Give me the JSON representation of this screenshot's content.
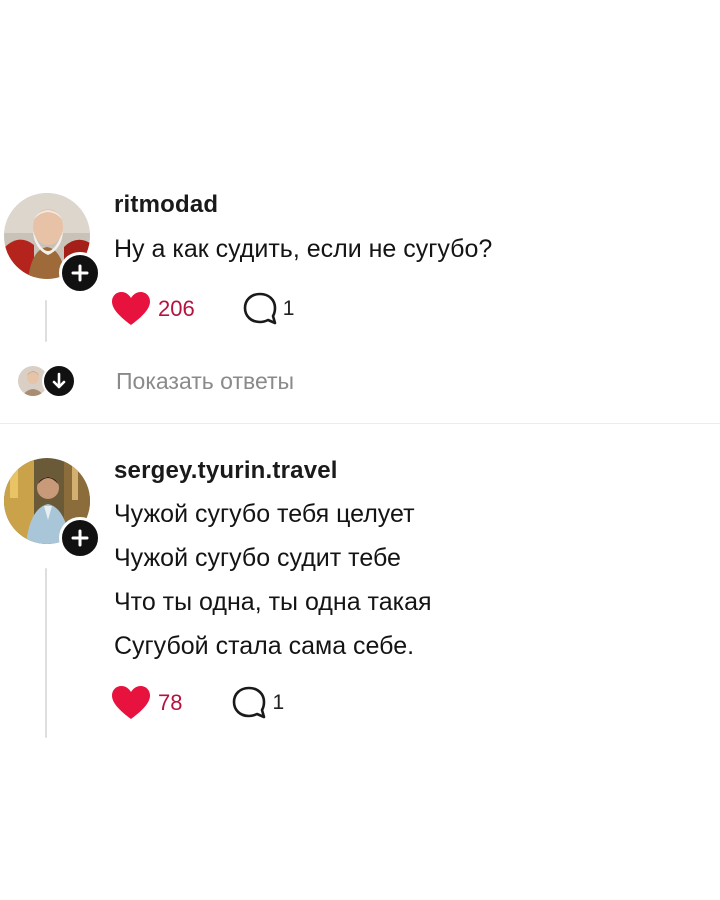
{
  "comments": [
    {
      "username": "ritmodad",
      "avatar_icon": "person-avatar",
      "text_lines": [
        "Ну а как судить, если не сугубо?"
      ],
      "likes": "206",
      "replies": "1"
    },
    {
      "username": "sergey.tyurin.travel",
      "avatar_icon": "person-avatar",
      "text_lines": [
        "Чужой сугубо тебя целует",
        "Чужой сугубо судит тебе",
        "Что ты одна, ты одна такая",
        "Сугубой стала сама себе."
      ],
      "likes": "78",
      "replies": "1"
    }
  ],
  "show_replies": {
    "label": "Показать ответы"
  },
  "colors": {
    "like": "#e8123f",
    "like_count": "#b4123f",
    "badge": "#111111",
    "muted_text": "#8a8a8a"
  },
  "icons": {
    "like": "heart-icon",
    "reply": "speech-bubble-icon",
    "follow": "plus-icon",
    "expand": "arrow-down-icon"
  }
}
